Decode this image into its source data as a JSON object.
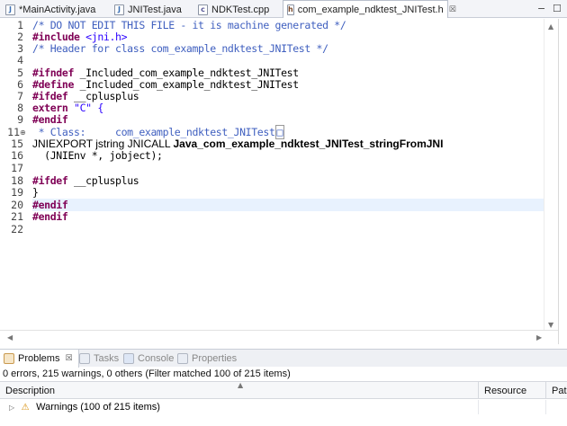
{
  "tabs": [
    {
      "label": "*MainActivity.java",
      "icon": "java-file-icon"
    },
    {
      "label": "JNITest.java",
      "icon": "java-file-icon"
    },
    {
      "label": "NDKTest.cpp",
      "icon": "cpp-file-icon"
    },
    {
      "label": "com_example_ndktest_JNITest.h",
      "icon": "header-file-icon",
      "active": true,
      "close": "☒"
    }
  ],
  "window_controls": {
    "minimize": "−",
    "maximize": "☐"
  },
  "editor": {
    "lines": [
      {
        "num": "1",
        "text": "/* DO NOT EDIT THIS FILE - it is machine generated */"
      },
      {
        "num": "2",
        "kw": "#include",
        "rest": " <jni.h>"
      },
      {
        "num": "3",
        "text": "/* Header for class com_example_ndktest_JNITest */"
      },
      {
        "num": "4",
        "text": ""
      },
      {
        "num": "5",
        "kw": "#ifndef",
        "rest": " _Included_com_example_ndktest_JNITest"
      },
      {
        "num": "6",
        "kw": "#define",
        "rest": " _Included_com_example_ndktest_JNITest"
      },
      {
        "num": "7",
        "kw": "#ifdef",
        "rest": " __cplusplus"
      },
      {
        "num": "8",
        "kw": "extern",
        "rest": " \"C\" {"
      },
      {
        "num": "9",
        "kw": "#endif",
        "rest": ""
      },
      {
        "num": "11",
        "text": " * Class:     com_example_ndktest_JNITest",
        "box": "□"
      },
      {
        "num": "15",
        "pre": "JNIEXPORT jstring JNICALL ",
        "fn": "Java_com_example_ndktest_JNITest_stringFromJNI"
      },
      {
        "num": "16",
        "text": "  (JNIEnv *, jobject);"
      },
      {
        "num": "17",
        "text": ""
      },
      {
        "num": "18",
        "kw": "#ifdef",
        "rest": " __cplusplus"
      },
      {
        "num": "19",
        "text": "}"
      },
      {
        "num": "20",
        "kw": "#endif",
        "rest": ""
      },
      {
        "num": "21",
        "kw": "#endif",
        "rest": ""
      },
      {
        "num": "22",
        "text": ""
      }
    ],
    "fold_marker": "⊕"
  },
  "bottom_panel": {
    "tabs": [
      {
        "label": "Problems",
        "active": true,
        "close": "☒"
      },
      {
        "label": "Tasks"
      },
      {
        "label": "Console"
      },
      {
        "label": "Properties"
      }
    ],
    "summary": "0 errors, 215 warnings, 0 others (Filter matched 100 of 215 items)",
    "columns": [
      "Description",
      "Resource",
      "Path"
    ],
    "rows": [
      {
        "description": "Warnings (100 of 215 items)"
      }
    ]
  },
  "colors": {
    "comment": "#3f5fbf",
    "keyword": "#7f0055",
    "string": "#2a00ff",
    "current_line": "#e8f2fe"
  }
}
